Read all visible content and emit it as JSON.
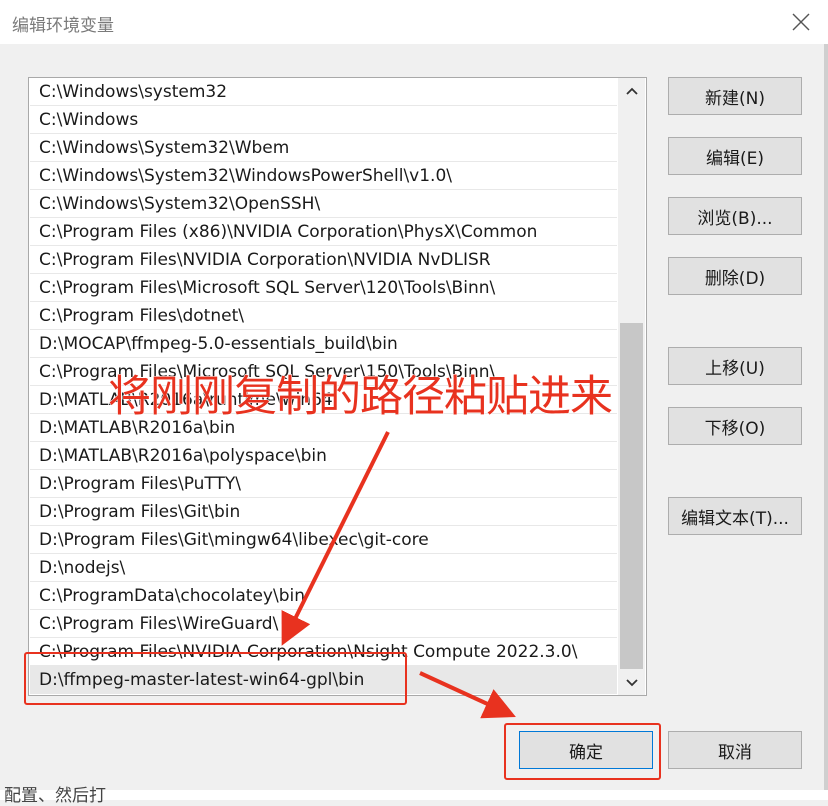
{
  "window": {
    "title": "编辑环境变量"
  },
  "paths": [
    "C:\\Windows\\system32",
    "C:\\Windows",
    "C:\\Windows\\System32\\Wbem",
    "C:\\Windows\\System32\\WindowsPowerShell\\v1.0\\",
    "C:\\Windows\\System32\\OpenSSH\\",
    "C:\\Program Files (x86)\\NVIDIA Corporation\\PhysX\\Common",
    "C:\\Program Files\\NVIDIA Corporation\\NVIDIA NvDLISR",
    "C:\\Program Files\\Microsoft SQL Server\\120\\Tools\\Binn\\",
    "C:\\Program Files\\dotnet\\",
    "D:\\MOCAP\\ffmpeg-5.0-essentials_build\\bin",
    "C:\\Program Files\\Microsoft SQL Server\\150\\Tools\\Binn\\",
    "D:\\MATLAB\\R2016a\\runtime\\win64",
    "D:\\MATLAB\\R2016a\\bin",
    "D:\\MATLAB\\R2016a\\polyspace\\bin",
    "D:\\Program Files\\PuTTY\\",
    "D:\\Program Files\\Git\\bin",
    "D:\\Program Files\\Git\\mingw64\\libexec\\git-core",
    "D:\\nodejs\\",
    "C:\\ProgramData\\chocolatey\\bin",
    "C:\\Program Files\\WireGuard\\",
    "C:\\Program Files\\NVIDIA Corporation\\Nsight Compute 2022.3.0\\",
    "D:\\ffmpeg-master-latest-win64-gpl\\bin"
  ],
  "selected_index": 21,
  "buttons": {
    "new": "新建(N)",
    "edit": "编辑(E)",
    "browse": "浏览(B)...",
    "delete": "删除(D)",
    "move_up": "上移(U)",
    "move_down": "下移(O)",
    "edit_text": "编辑文本(T)...",
    "ok": "确定",
    "cancel": "取消"
  },
  "annotation": {
    "text": "将刚刚复制的路径粘贴进来",
    "color": "#e8321f"
  },
  "background_text": "配置、然后打",
  "icons": {
    "close": "close-icon",
    "scroll_up": "chevron-up-icon",
    "scroll_down": "chevron-down-icon"
  }
}
